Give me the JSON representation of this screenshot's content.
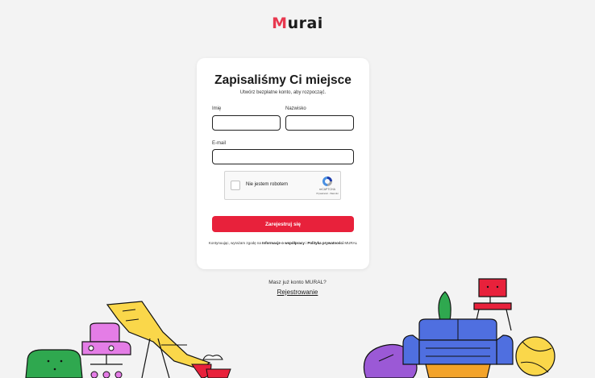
{
  "brand": {
    "logo_m": "M",
    "logo_rest": "urai"
  },
  "form": {
    "title": "Zapisaliśmy Ci miejsce",
    "subtitle": "Utwórz bezpłatne konto, aby rozpocząć.",
    "first_name_label": "Imię",
    "last_name_label": "Nazwisko",
    "first_name_value": "",
    "last_name_value": "",
    "email_label": "E-mail",
    "email_value": "",
    "submit_label": "Zarejestruj się"
  },
  "captcha": {
    "label": "Nie jestem robotem",
    "brand": "reCAPTCHA",
    "links": "Prywatność - Warunki"
  },
  "terms": {
    "prefix": "Kontynuując, wyrażam zgodę na ",
    "link1": "Informacje o współpracy",
    "middle": " i ",
    "link2": "Polityka prywatności",
    "suffix": " MURAL"
  },
  "signin": {
    "question": "Masz już konto MURAL?",
    "link": "Rejestrowanie"
  },
  "colors": {
    "accent": "#e8213b",
    "logo_m": "#e8384f",
    "background": "#f3f3f3"
  },
  "illustrations": [
    "furniture-left-illustration",
    "furniture-right-illustration"
  ]
}
